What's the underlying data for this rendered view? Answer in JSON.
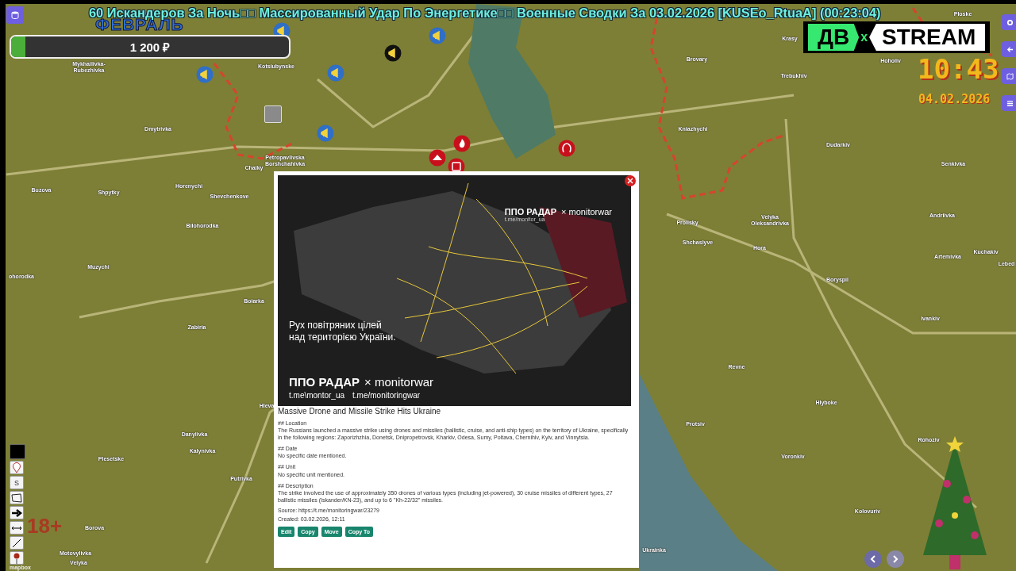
{
  "stream_title": "60 Искандеров За Ночь□□ Массированный Удар По Энергетике□□ Военные Сводки За 03.02.2026 [KUSEo_RtuaA] (00:23:04)",
  "month": "ФЕВРАЛЬ",
  "donation": {
    "amount": "1 200 ₽",
    "level": 0.05
  },
  "logo": {
    "left": "ДВ",
    "joiner": "x",
    "right": "STREAM"
  },
  "clock": {
    "time": "10:43",
    "date": "04.02.2026"
  },
  "age_rating": "18+",
  "attribution": "mapbox",
  "places": [
    "Mykhailivka-\nRubezhivka",
    "Kotsiubynske",
    "Dmytrivka",
    "Chaiky",
    "Petropavlivska\nBorshchahivka",
    "Horenychi",
    "Buzova",
    "Shpytky",
    "Shevchenkove",
    "Bilohorodka",
    "Muzychi",
    "ohorodka",
    "Boiarka",
    "Zabiria",
    "Hleva",
    "Danylivka",
    "Kalynivka",
    "Plesetske",
    "Putrivka",
    "Borova",
    "Motovylivka",
    "Velyka",
    "Brovary",
    "Krasy",
    "Ploske",
    "Hoholiv",
    "Trebukhiv",
    "Kniazhychi",
    "Dudarkiv",
    "Senkivka",
    "Prolisky",
    "Velyka\nOleksandrivka",
    "Andriivka",
    "Shchaslyve",
    "Hora",
    "Kuchakiv",
    "Artemivka",
    "Lebed",
    "Boryspil",
    "Ivankiv",
    "Revne",
    "Hlyboke",
    "Protsiv",
    "Rohoziv",
    "Voronkiv",
    "Kolovuriv",
    "Ukrainka"
  ],
  "markers": [
    {
      "kind": "megaphone",
      "color": "#2f6fc8"
    },
    {
      "kind": "megaphone",
      "color": "#2f6fc8"
    },
    {
      "kind": "megaphone",
      "color": "#2f6fc8"
    },
    {
      "kind": "megaphone",
      "color": "#2f6fc8"
    },
    {
      "kind": "megaphone",
      "color": "#2f6fc8"
    },
    {
      "kind": "megaphone",
      "color": "#111111"
    },
    {
      "kind": "fire",
      "color": "#c8101c"
    },
    {
      "kind": "warning",
      "color": "#c8101c"
    },
    {
      "kind": "building",
      "color": "#c8101c"
    },
    {
      "kind": "explosion",
      "color": "#c8101c"
    }
  ],
  "tools": {
    "color": "#000000",
    "text_label": "S"
  },
  "popup": {
    "image": {
      "top_brand": "ППО РАДАР",
      "top_partner": "× monitorwar",
      "top_link": "t.me/monitor_ua",
      "headline": "Рух повітряних цілей\nнад територією України.",
      "brand": "ППО РАДАР",
      "partner": "× monitorwar",
      "link_left": "t.me\\montor_ua",
      "link_right": "t.me/monitoringwar"
    },
    "title": "Massive Drone and Missile Strike Hits Ukraine",
    "sections": [
      {
        "heading": "## Location",
        "body": "The Russians launched a massive strike using drones and missiles (ballistic, cruise, and anti-ship types) on the territory of Ukraine, specifically in the following regions: Zaporizhzhia, Donetsk, Dnipropetrovsk, Kharkiv, Odesa, Sumy, Poltava, Chernihiv, Kyiv, and Vinnytsia."
      },
      {
        "heading": "## Date",
        "body": "No specific date mentioned."
      },
      {
        "heading": "## Unit",
        "body": "No specific unit mentioned."
      },
      {
        "heading": "## Description",
        "body": "The strike involved the use of approximately 350 drones of various types (including jet-powered), 30 cruise missiles of different types, 27 ballistic missiles (Iskander/KN-23), and up to 6 \"Kh-22/32\" missiles."
      }
    ],
    "source": "Source: https://t.me/monitoringwar/23279",
    "created": "Created: 03.02.2026, 12:11",
    "buttons": [
      "Edit",
      "Copy",
      "Move",
      "Copy To"
    ]
  }
}
